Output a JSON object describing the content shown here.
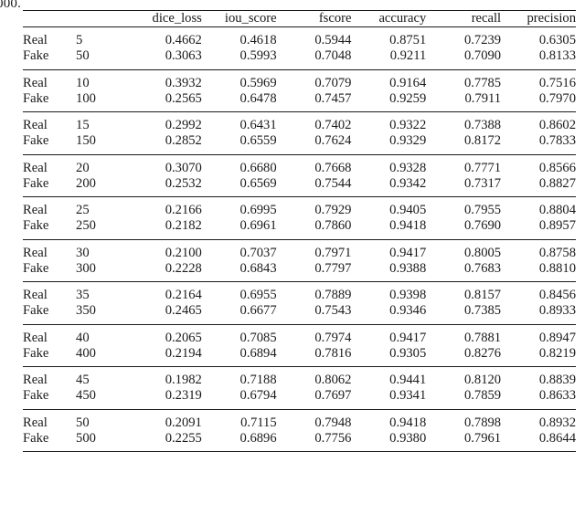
{
  "caption_fragment": "000.",
  "table": {
    "columns": [
      "dice_loss",
      "iou_score",
      "fscore",
      "accuracy",
      "recall",
      "precision"
    ],
    "row_label_headers": [
      "",
      ""
    ],
    "groups": [
      {
        "rows": [
          {
            "kind": "Real",
            "epoch": "5",
            "values": [
              "0.4662",
              "0.4618",
              "0.5944",
              "0.8751",
              "0.7239",
              "0.6305"
            ],
            "bold": [
              false,
              false,
              false,
              false,
              false,
              false
            ]
          },
          {
            "kind": "Fake",
            "epoch": "50",
            "values": [
              "0.3063",
              "0.5993",
              "0.7048",
              "0.9211",
              "0.7090",
              "0.8133"
            ],
            "bold": [
              true,
              true,
              true,
              true,
              true,
              true
            ]
          }
        ]
      },
      {
        "rows": [
          {
            "kind": "Real",
            "epoch": "10",
            "values": [
              "0.3932",
              "0.5969",
              "0.7079",
              "0.9164",
              "0.7785",
              "0.7516"
            ],
            "bold": [
              false,
              false,
              false,
              false,
              false,
              false
            ]
          },
          {
            "kind": "Fake",
            "epoch": "100",
            "values": [
              "0.2565",
              "0.6478",
              "0.7457",
              "0.9259",
              "0.7911",
              "0.7970"
            ],
            "bold": [
              true,
              true,
              true,
              true,
              true,
              true
            ]
          }
        ]
      },
      {
        "rows": [
          {
            "kind": "Real",
            "epoch": "15",
            "values": [
              "0.2992",
              "0.6431",
              "0.7402",
              "0.9322",
              "0.7388",
              "0.8602"
            ],
            "bold": [
              false,
              false,
              false,
              false,
              false,
              true
            ]
          },
          {
            "kind": "Fake",
            "epoch": "150",
            "values": [
              "0.2852",
              "0.6559",
              "0.7624",
              "0.9329",
              "0.8172",
              "0.7833"
            ],
            "bold": [
              true,
              true,
              true,
              true,
              true,
              false
            ]
          }
        ]
      },
      {
        "rows": [
          {
            "kind": "Real",
            "epoch": "20",
            "values": [
              "0.3070",
              "0.6680",
              "0.7668",
              "0.9328",
              "0.7771",
              "0.8566"
            ],
            "bold": [
              false,
              true,
              true,
              false,
              true,
              false
            ]
          },
          {
            "kind": "Fake",
            "epoch": "200",
            "values": [
              "0.2532",
              "0.6569",
              "0.7544",
              "0.9342",
              "0.7317",
              "0.8827"
            ],
            "bold": [
              true,
              false,
              false,
              true,
              false,
              true
            ]
          }
        ]
      },
      {
        "rows": [
          {
            "kind": "Real",
            "epoch": "25",
            "values": [
              "0.2166",
              "0.6995",
              "0.7929",
              "0.9405",
              "0.7955",
              "0.8804"
            ],
            "bold": [
              true,
              true,
              true,
              false,
              true,
              false
            ]
          },
          {
            "kind": "Fake",
            "epoch": "250",
            "values": [
              "0.2182",
              "0.6961",
              "0.7860",
              "0.9418",
              "0.7690",
              "0.8957"
            ],
            "bold": [
              false,
              false,
              false,
              true,
              false,
              true
            ]
          }
        ]
      },
      {
        "rows": [
          {
            "kind": "Real",
            "epoch": "30",
            "values": [
              "0.2100",
              "0.7037",
              "0.7971",
              "0.9417",
              "0.8005",
              "0.8758"
            ],
            "bold": [
              true,
              true,
              true,
              true,
              true,
              false
            ]
          },
          {
            "kind": "Fake",
            "epoch": "300",
            "values": [
              "0.2228",
              "0.6843",
              "0.7797",
              "0.9388",
              "0.7683",
              "0.8810"
            ],
            "bold": [
              false,
              false,
              false,
              false,
              false,
              true
            ]
          }
        ]
      },
      {
        "rows": [
          {
            "kind": "Real",
            "epoch": "35",
            "values": [
              "0.2164",
              "0.6955",
              "0.7889",
              "0.9398",
              "0.8157",
              "0.8456"
            ],
            "bold": [
              true,
              true,
              true,
              true,
              true,
              false
            ]
          },
          {
            "kind": "Fake",
            "epoch": "350",
            "values": [
              "0.2465",
              "0.6677",
              "0.7543",
              "0.9346",
              "0.7385",
              "0.8933"
            ],
            "bold": [
              false,
              false,
              false,
              false,
              false,
              true
            ]
          }
        ]
      },
      {
        "rows": [
          {
            "kind": "Real",
            "epoch": "40",
            "values": [
              "0.2065",
              "0.7085",
              "0.7974",
              "0.9417",
              "0.7881",
              "0.8947"
            ],
            "bold": [
              true,
              true,
              true,
              true,
              false,
              true
            ]
          },
          {
            "kind": "Fake",
            "epoch": "400",
            "values": [
              "0.2194",
              "0.6894",
              "0.7816",
              "0.9305",
              "0.8276",
              "0.8219"
            ],
            "bold": [
              false,
              false,
              false,
              false,
              true,
              false
            ]
          }
        ]
      },
      {
        "rows": [
          {
            "kind": "Real",
            "epoch": "45",
            "values": [
              "0.1982",
              "0.7188",
              "0.8062",
              "0.9441",
              "0.8120",
              "0.8839"
            ],
            "bold": [
              true,
              true,
              true,
              true,
              true,
              true
            ]
          },
          {
            "kind": "Fake",
            "epoch": "450",
            "values": [
              "0.2319",
              "0.6794",
              "0.7697",
              "0.9341",
              "0.7859",
              "0.8633"
            ],
            "bold": [
              false,
              false,
              false,
              false,
              false,
              false
            ]
          }
        ]
      },
      {
        "rows": [
          {
            "kind": "Real",
            "epoch": "50",
            "values": [
              "0.2091",
              "0.7115",
              "0.7948",
              "0.9418",
              "0.7898",
              "0.8932"
            ],
            "bold": [
              true,
              true,
              true,
              true,
              false,
              true
            ]
          },
          {
            "kind": "Fake",
            "epoch": "500",
            "values": [
              "0.2255",
              "0.6896",
              "0.7756",
              "0.9380",
              "0.7961",
              "0.8644"
            ],
            "bold": [
              false,
              false,
              false,
              false,
              true,
              false
            ]
          }
        ]
      }
    ]
  }
}
